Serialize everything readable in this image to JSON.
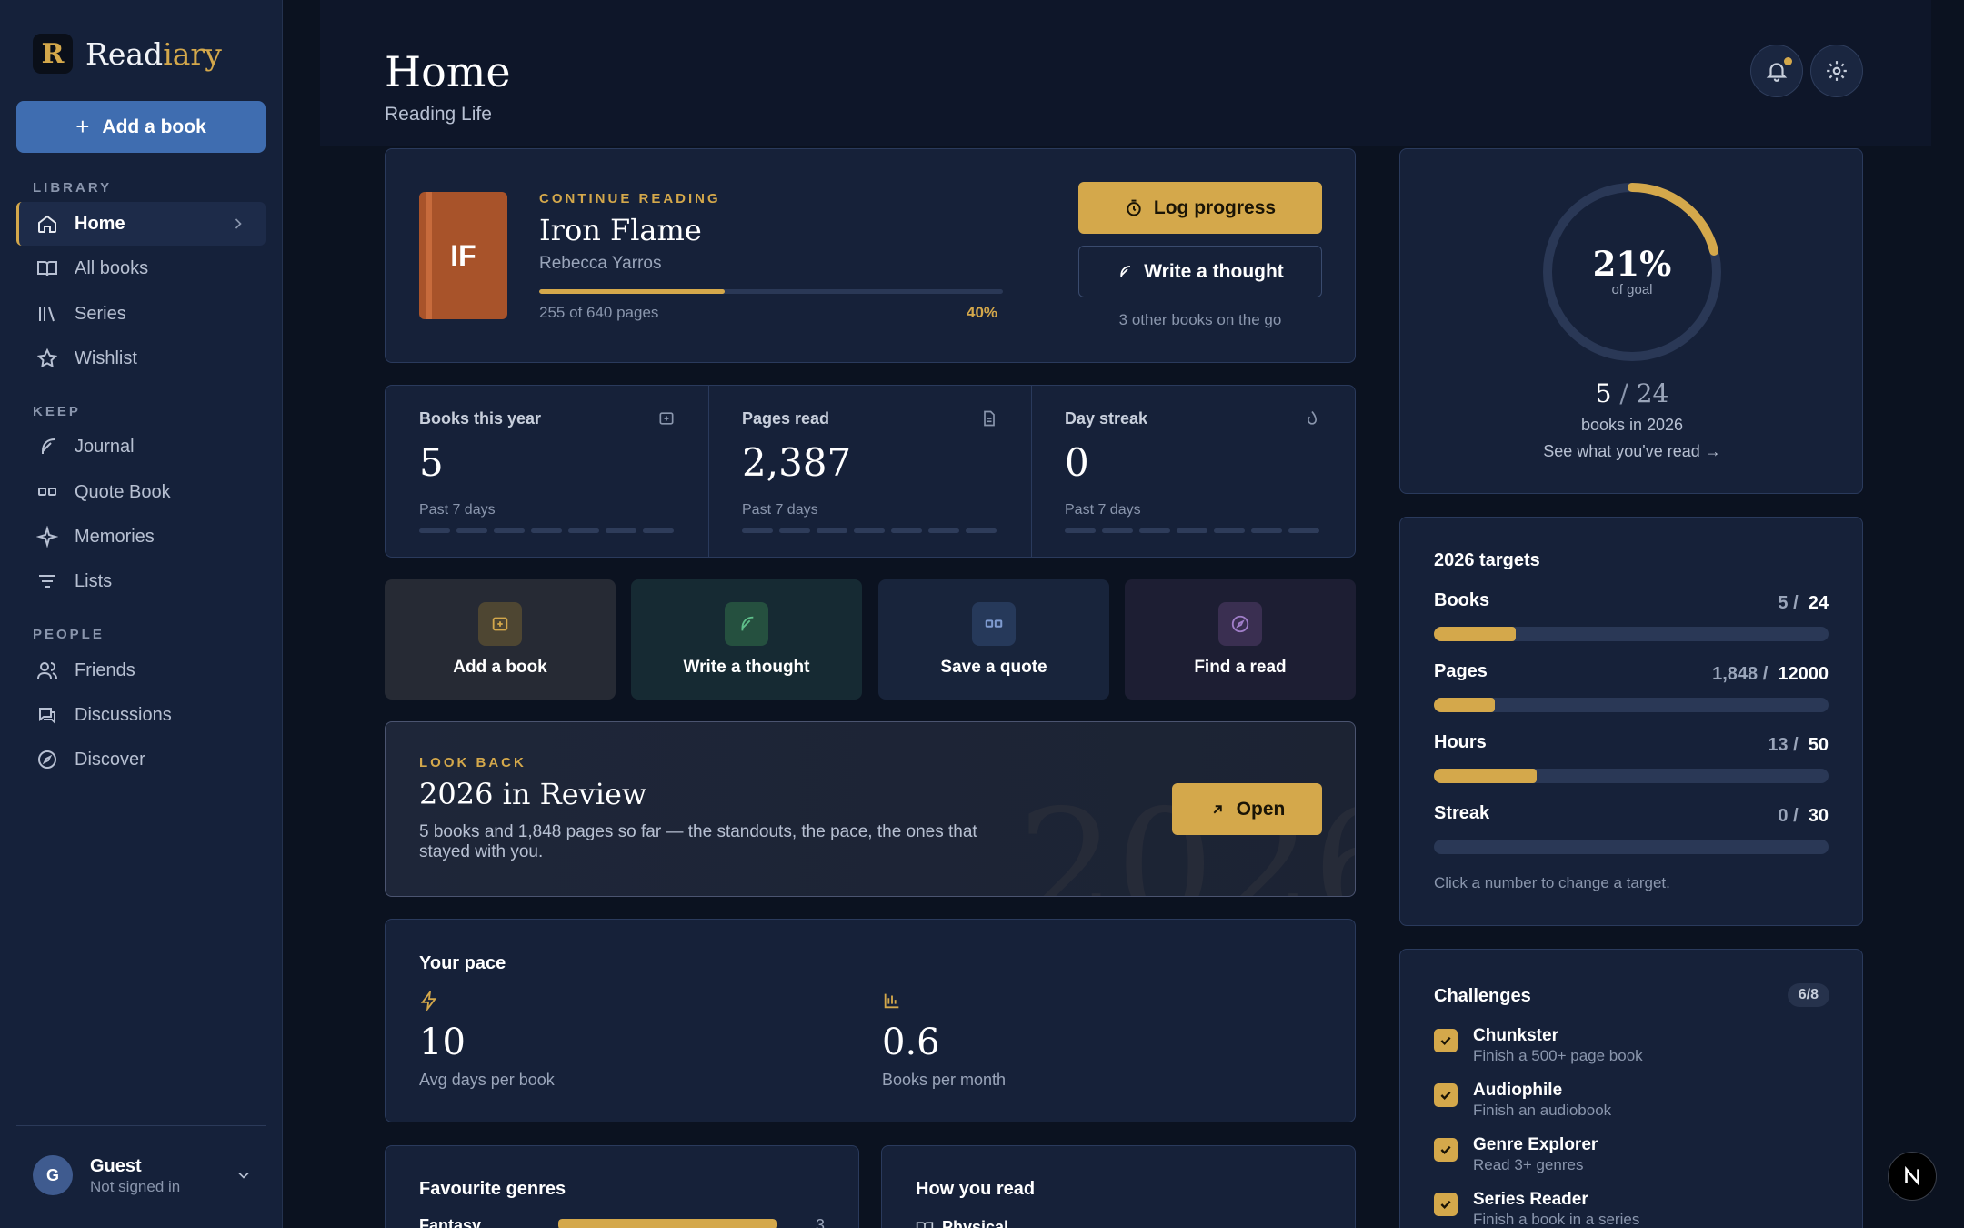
{
  "app": {
    "brand_prefix": "Read",
    "brand_suffix": "iary",
    "logo_letter": "R"
  },
  "sidebar": {
    "add_button": "Add a book",
    "sections": [
      {
        "label": "LIBRARY",
        "items": [
          {
            "label": "Home",
            "icon": "home-icon",
            "active": true
          },
          {
            "label": "All books",
            "icon": "book-open-icon"
          },
          {
            "label": "Series",
            "icon": "library-icon"
          },
          {
            "label": "Wishlist",
            "icon": "star-icon"
          }
        ]
      },
      {
        "label": "KEEP",
        "items": [
          {
            "label": "Journal",
            "icon": "feather-icon"
          },
          {
            "label": "Quote Book",
            "icon": "quote-icon"
          },
          {
            "label": "Memories",
            "icon": "sparkle-icon"
          },
          {
            "label": "Lists",
            "icon": "list-icon"
          }
        ]
      },
      {
        "label": "PEOPLE",
        "items": [
          {
            "label": "Friends",
            "icon": "users-icon"
          },
          {
            "label": "Discussions",
            "icon": "chat-icon"
          },
          {
            "label": "Discover",
            "icon": "compass-icon"
          }
        ]
      }
    ],
    "user": {
      "initial": "G",
      "name": "Guest",
      "status": "Not signed in"
    }
  },
  "header": {
    "title": "Home",
    "subtitle": "Reading Life"
  },
  "continue_reading": {
    "eyebrow": "CONTINUE READING",
    "cover_initials": "IF",
    "title": "Iron Flame",
    "author": "Rebecca Yarros",
    "pages_text": "255 of 640 pages",
    "percent_text": "40%",
    "progress": 0.4,
    "log_button": "Log progress",
    "thought_button": "Write a thought",
    "other_books": "3 other books on the go"
  },
  "stats": [
    {
      "label": "Books this year",
      "value": "5",
      "sub": "Past 7 days",
      "icon": "book-plus-icon"
    },
    {
      "label": "Pages read",
      "value": "2,387",
      "sub": "Past 7 days",
      "icon": "document-icon"
    },
    {
      "label": "Day streak",
      "value": "0",
      "sub": "Past 7 days",
      "icon": "flame-icon"
    }
  ],
  "quick_actions": [
    {
      "label": "Add a book",
      "icon": "book-plus-icon"
    },
    {
      "label": "Write a thought",
      "icon": "feather-icon"
    },
    {
      "label": "Save a quote",
      "icon": "quote-icon"
    },
    {
      "label": "Find a read",
      "icon": "compass-icon"
    }
  ],
  "look_back": {
    "eyebrow": "LOOK BACK",
    "title": "2026 in Review",
    "text": "5 books and 1,848 pages so far — the standouts, the pace, the ones that stayed with you.",
    "watermark": "2026",
    "button": "Open"
  },
  "pace": {
    "title": "Your pace",
    "items": [
      {
        "value": "10",
        "label": "Avg days per book",
        "icon": "bolt-icon"
      },
      {
        "value": "0.6",
        "label": "Books per month",
        "icon": "bar-chart-icon"
      }
    ]
  },
  "genres": {
    "title": "Favourite genres",
    "first_genre": "Fantasy",
    "first_count": "3",
    "first_fraction": 1.0
  },
  "how_read": {
    "title": "How you read",
    "first_item": "Physical"
  },
  "goal": {
    "percent_text": "21%",
    "caption": "of goal",
    "progress": 0.21,
    "current": "5",
    "total": "24",
    "year_text": "books in 2026",
    "link": "See what you've read →"
  },
  "targets": {
    "title": "2026 targets",
    "rows": [
      {
        "name": "Books",
        "current": "5",
        "target": "24",
        "fraction": 0.208
      },
      {
        "name": "Pages",
        "current": "1,848",
        "target": "12000",
        "fraction": 0.154
      },
      {
        "name": "Hours",
        "current": "13",
        "target": "50",
        "fraction": 0.26
      },
      {
        "name": "Streak",
        "current": "0",
        "target": "30",
        "fraction": 0.0
      }
    ],
    "hint": "Click a number to change a target."
  },
  "challenges": {
    "title": "Challenges",
    "badge": "6/8",
    "items": [
      {
        "title": "Chunkster",
        "sub": "Finish a 500+ page book",
        "done": true
      },
      {
        "title": "Audiophile",
        "sub": "Finish an audiobook",
        "done": true
      },
      {
        "title": "Genre Explorer",
        "sub": "Read 3+ genres",
        "done": true
      },
      {
        "title": "Series Reader",
        "sub": "Finish a book in a series",
        "done": true
      }
    ]
  },
  "colors": {
    "accent": "#d4a84b",
    "primary": "#3f6db0",
    "background": "#0b1220",
    "card": "#162139",
    "sidebar": "#15213a"
  }
}
